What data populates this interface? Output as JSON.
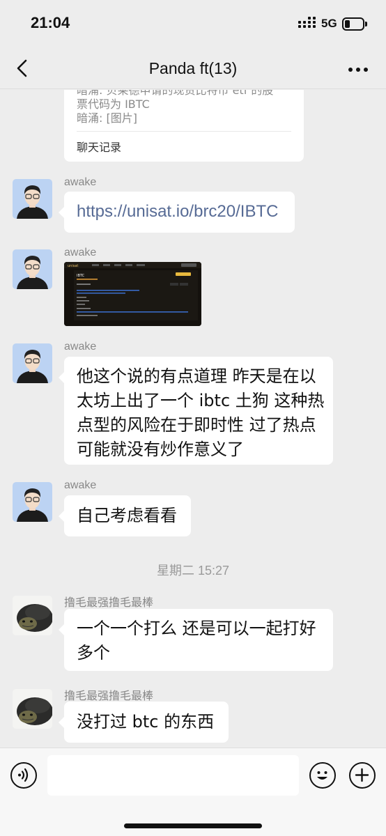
{
  "status_bar": {
    "time": "21:04",
    "network": "5G"
  },
  "header": {
    "title": "Panda ft(13)"
  },
  "forward_card": {
    "lines": [
      "暗涌: 贝莱德申请的现货比特币 etf 的股",
      "票代码为 IBTC",
      "暗涌: [图片]"
    ],
    "footer": "聊天记录"
  },
  "messages": [
    {
      "sender": "awake",
      "text": "https://unisat.io/brc20/IBTC"
    },
    {
      "sender": "awake",
      "image": "screenshot",
      "thumb_title": "IBTC",
      "thumb_brand": "unisat"
    },
    {
      "sender": "awake",
      "lines": [
        "他这个说的有点道理 昨天是在以",
        "太坊上出了一个 ibtc 土狗 这种热",
        "点型的风险在于即时性 过了热点",
        " 可能就没有炒作意义了"
      ]
    },
    {
      "sender": "awake",
      "text": "自己考虑看看"
    },
    {
      "sender": "撸毛最强撸毛最棒",
      "lines": [
        "一个一个打么 还是可以一起打好",
        "多个"
      ]
    },
    {
      "sender": "撸毛最强撸毛最棒",
      "text": "没打过 btc 的东西"
    }
  ],
  "timestamp": "星期二 15:27",
  "input": {
    "value": ""
  },
  "icons": {
    "back": "chevron-left-icon",
    "more": "more-icon",
    "voice": "voice-icon",
    "emoji": "emoji-icon",
    "plus": "plus-icon"
  },
  "colors": {
    "link": "#576b95",
    "background": "#ededed",
    "bubble": "#ffffff"
  }
}
